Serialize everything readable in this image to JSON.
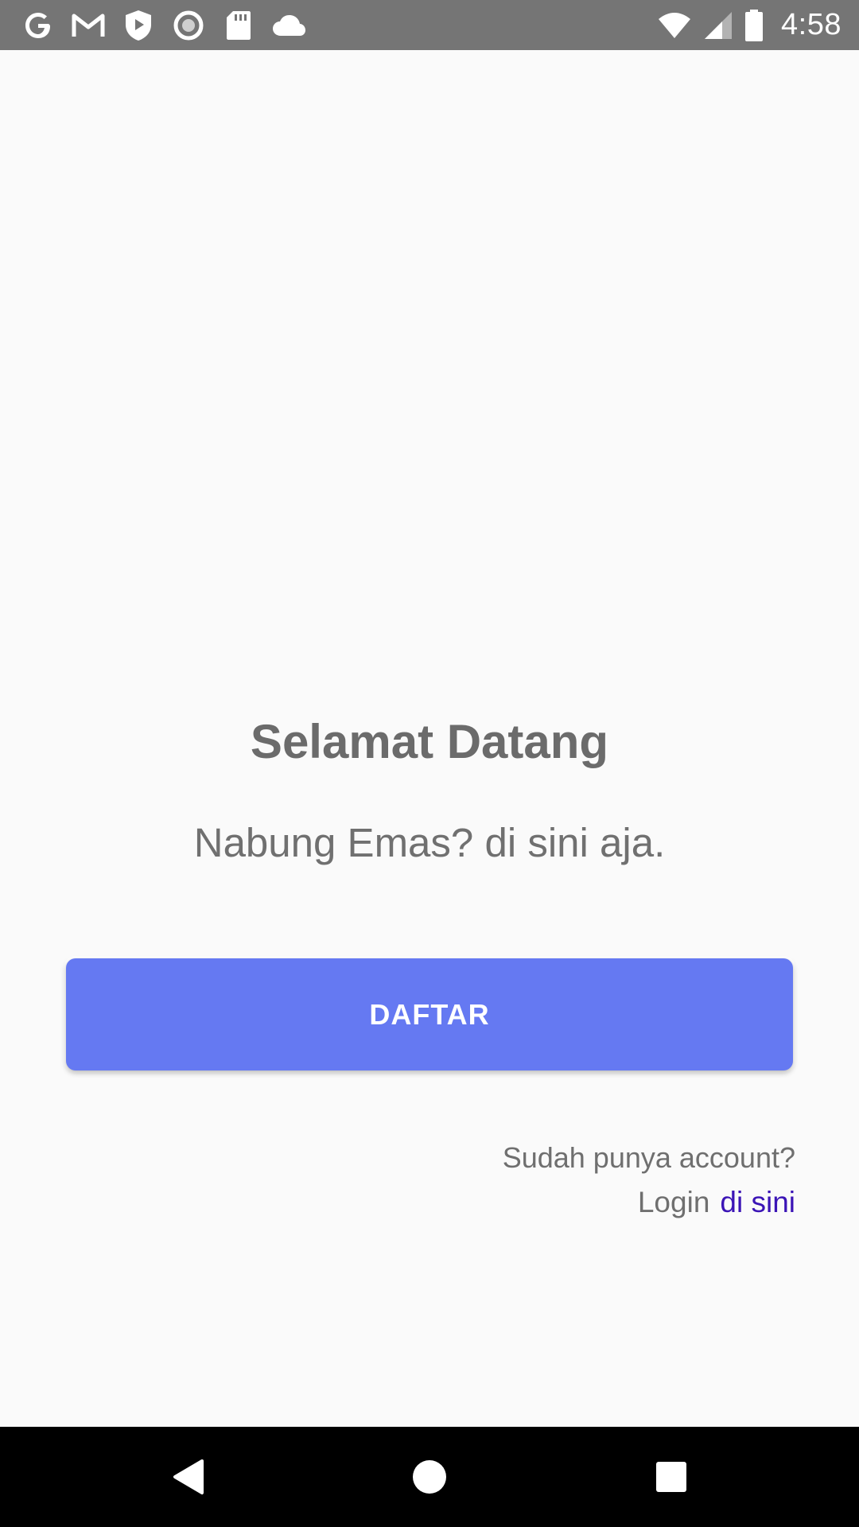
{
  "status_bar": {
    "time": "4:58",
    "left_icons": [
      "google-icon",
      "gmail-icon",
      "shield-play-icon",
      "record-icon",
      "sd-card-icon",
      "cloud-icon"
    ],
    "right_icons": [
      "wifi-icon",
      "cell-signal-icon",
      "battery-icon"
    ],
    "background": "#757575"
  },
  "welcome": {
    "title": "Selamat Datang",
    "subtitle": "Nabung Emas? di sini aja."
  },
  "register": {
    "button_label": "DAFTAR",
    "button_color": "#6579f2"
  },
  "login": {
    "question": "Sudah punya account?",
    "label": "Login",
    "link_text": "di sini",
    "link_color": "#3b14b6"
  },
  "nav_bar": {
    "buttons": [
      "back-icon",
      "home-icon",
      "recents-icon"
    ]
  }
}
